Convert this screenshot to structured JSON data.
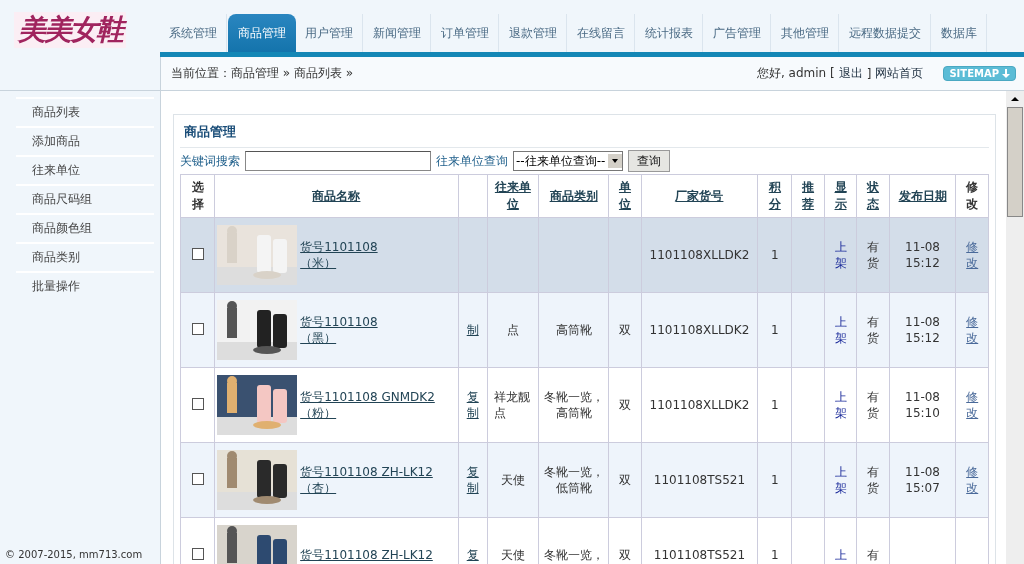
{
  "logo": "美美女鞋",
  "nav": [
    {
      "label": "系统管理",
      "selected": false
    },
    {
      "label": "商品管理",
      "selected": true
    },
    {
      "label": "用户管理",
      "selected": false
    },
    {
      "label": "新闻管理",
      "selected": false
    },
    {
      "label": "订单管理",
      "selected": false
    },
    {
      "label": "退款管理",
      "selected": false
    },
    {
      "label": "在线留言",
      "selected": false
    },
    {
      "label": "统计报表",
      "selected": false
    },
    {
      "label": "广告管理",
      "selected": false
    },
    {
      "label": "其他管理",
      "selected": false
    },
    {
      "label": "远程数据提交",
      "selected": false
    },
    {
      "label": "数据库",
      "selected": false
    }
  ],
  "breadcrumb": "当前位置：商品管理 » 商品列表 »",
  "user": {
    "greeting": "您好, admin [",
    "logout": "退出",
    "close": "]",
    "home": "网站首页",
    "sitemap": "SITEMAP"
  },
  "sidebar": {
    "items": [
      "商品列表",
      "添加商品",
      "往来单位",
      "商品尺码组",
      "商品颜色组",
      "商品类别",
      "批量操作"
    ],
    "footer": "© 2007-2015, mm713.com"
  },
  "panel": {
    "title": "商品管理",
    "search": {
      "label": "关键词搜索"
    },
    "partner_filter": {
      "label": "往来单位查询",
      "value": "--往来单位查询--"
    },
    "search_button": "查询",
    "columns": [
      {
        "label": "选择",
        "sortable": false
      },
      {
        "label": "商品名称",
        "sortable": true
      },
      {},
      {
        "label": "往来单位",
        "sortable": true
      },
      {
        "label": "商品类别",
        "sortable": true
      },
      {
        "label": "单位",
        "sortable": true
      },
      {
        "label": "厂家货号",
        "sortable": true
      },
      {
        "label": "积分",
        "sortable": true
      },
      {
        "label": "推荐",
        "sortable": true
      },
      {
        "label": "显示",
        "sortable": true
      },
      {
        "label": "状态",
        "sortable": true
      },
      {
        "label": "发布日期",
        "sortable": true
      },
      {
        "label": "修改",
        "sortable": false
      }
    ],
    "rows": [
      {
        "highlighted": true,
        "checked": false,
        "name": "货号1101108",
        "variant": "（米）",
        "code": "1101108XLLDK2",
        "points": "1",
        "display": "上架",
        "stock": "有货",
        "date": "11-08 15:12",
        "edit": "修改"
      },
      {
        "highlighted": false,
        "checked": false,
        "name": "货号1101108",
        "variant": "（黑）",
        "copy": "制",
        "partner": "点",
        "category": "高筒靴",
        "unit": "双",
        "code": "1101108XLLDK2",
        "points": "1",
        "display": "上架",
        "stock": "有货",
        "date": "11-08 15:12",
        "edit": "修改"
      },
      {
        "highlighted": false,
        "checked": false,
        "name": "货号1101108 GNMDK2",
        "variant": "（粉）",
        "copy": "复制",
        "partner": "祥龙靓点",
        "category": "冬靴一览，高筒靴",
        "unit": "双",
        "code": "1101108XLLDK2",
        "points": "1",
        "display": "上架",
        "stock": "有货",
        "date": "11-08 15:10",
        "edit": "修改"
      },
      {
        "highlighted": false,
        "checked": false,
        "name": "货号1101108 ZH-LK12",
        "variant": "（杏）",
        "copy": "复制",
        "partner": "天使",
        "category": "冬靴一览，低筒靴",
        "unit": "双",
        "code": "1101108TS521",
        "points": "1",
        "display": "上架",
        "stock": "有货",
        "date": "11-08 15:07",
        "edit": "修改"
      },
      {
        "highlighted": false,
        "checked": false,
        "name": "货号1101108 ZH-LK12",
        "copy": "复",
        "partner": "天使",
        "category": "冬靴一览，",
        "unit": "双",
        "code": "1101108TS521",
        "points": "1",
        "display": "上",
        "stock": "有"
      }
    ]
  }
}
